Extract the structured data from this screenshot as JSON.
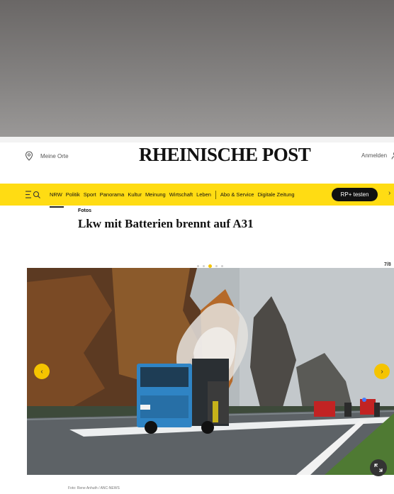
{
  "header": {
    "location_label": "Meine Orte",
    "logo": "RHEINISCHE POST",
    "login_label": "Anmelden"
  },
  "nav": {
    "items": [
      "NRW",
      "Politik",
      "Sport",
      "Panorama",
      "Kultur",
      "Meinung",
      "Wirtschaft",
      "Leben"
    ],
    "secondary": [
      "Abo & Service",
      "Digitale Zeitung"
    ],
    "cta": "RP+ testen",
    "accent_color": "#ffdc13"
  },
  "article": {
    "kicker": "Fotos",
    "title": "Lkw mit Batterien brennt auf A31"
  },
  "gallery": {
    "counter": "7/8",
    "credit": "Foto: Rene Anhuth / ANC-NEWS",
    "dot_count": 5,
    "active_dot": 3,
    "arrow_color": "#f5c400",
    "prev_icon": "chevron-left-icon",
    "next_icon": "chevron-right-icon",
    "expand_icon": "expand-icon"
  }
}
